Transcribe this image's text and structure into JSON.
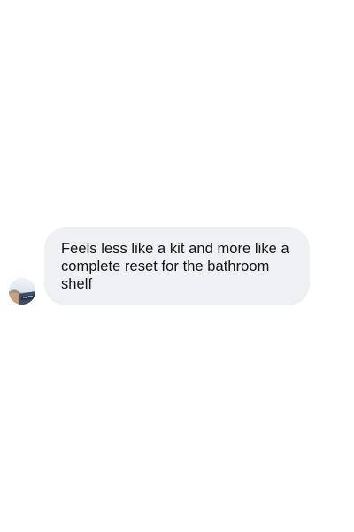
{
  "conversation": {
    "messages": [
      {
        "text": "Feels less like a kit and more like a complete reset for the bathroom shelf",
        "avatar_icon": "user-avatar-photo"
      }
    ]
  },
  "colors": {
    "bubble_background": "#eff0f3",
    "text": "#141414",
    "page_background": "#ffffff"
  }
}
